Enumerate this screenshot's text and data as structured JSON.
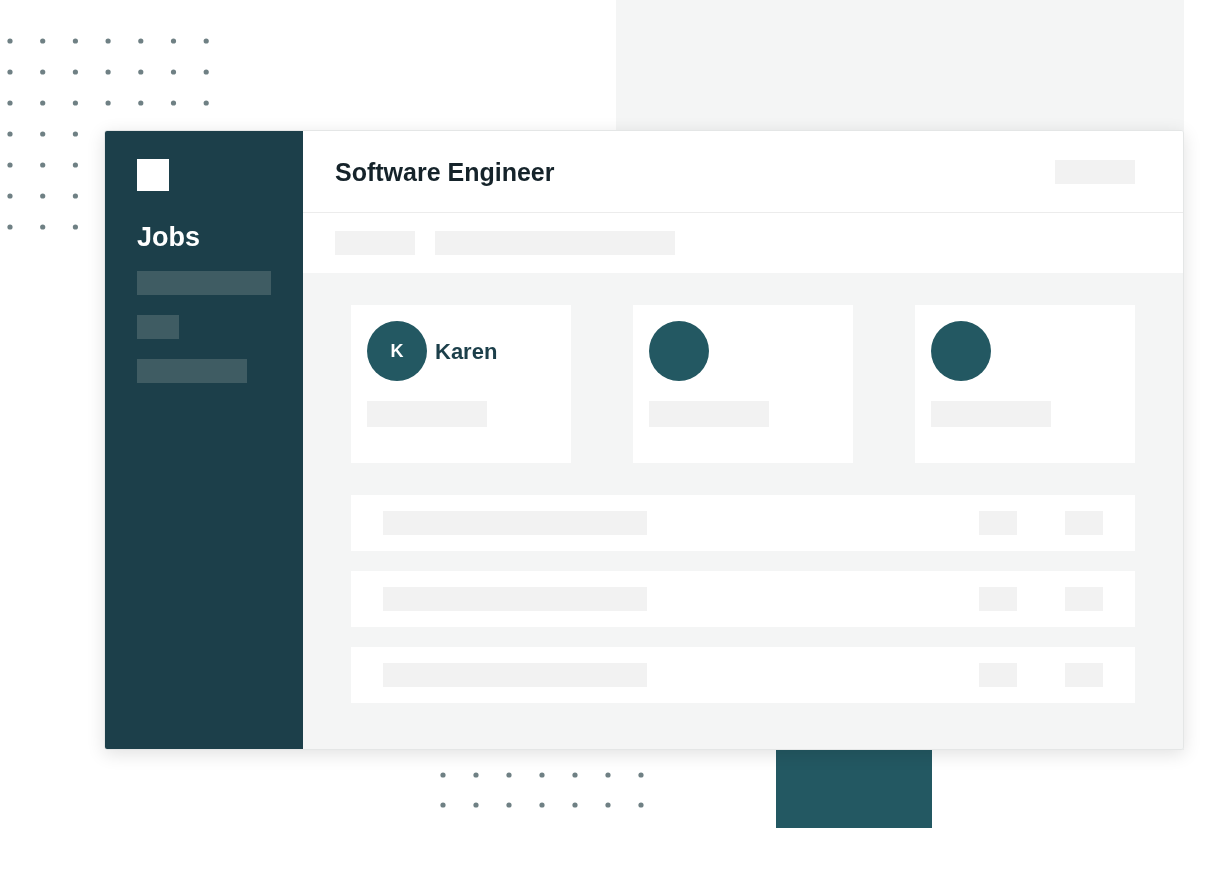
{
  "window": {
    "title": "Software Engineer"
  },
  "sidebar": {
    "title": "Jobs",
    "items": [
      {
        "kind": "placeholder"
      },
      {
        "kind": "placeholder"
      },
      {
        "kind": "placeholder"
      }
    ]
  },
  "candidates": [
    {
      "kind": "person",
      "initial": "K",
      "name": "Karen"
    },
    {
      "kind": "placeholder"
    },
    {
      "kind": "placeholder"
    }
  ],
  "rows": [
    {
      "kind": "placeholder"
    },
    {
      "kind": "placeholder"
    },
    {
      "kind": "placeholder"
    }
  ]
}
